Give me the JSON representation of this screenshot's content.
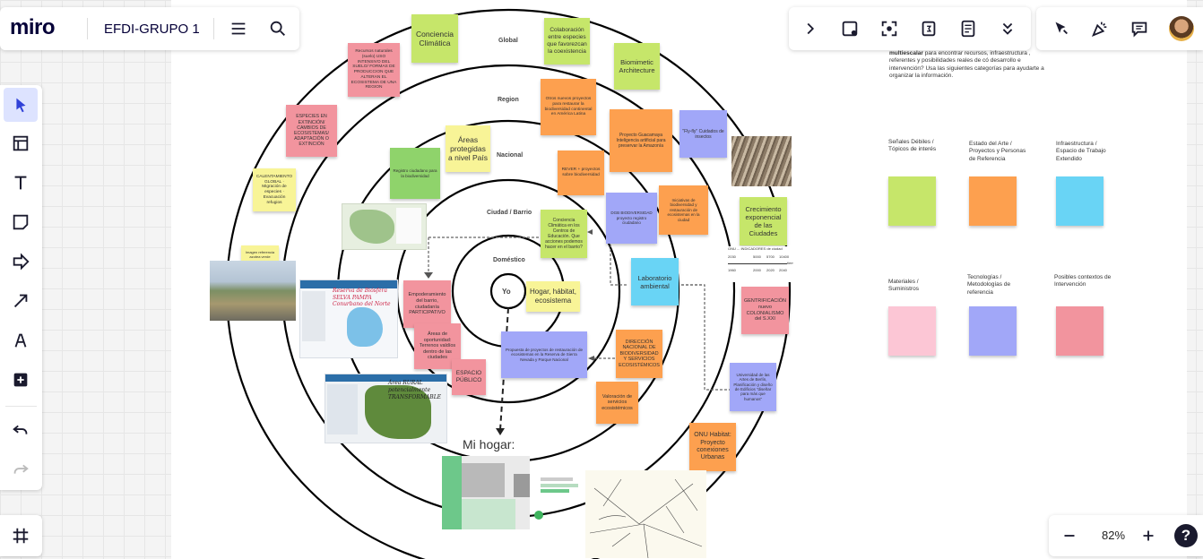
{
  "board": {
    "logo": "miro",
    "title": "EFDI-GRUPO 1",
    "zoom": "82%",
    "help": "?"
  },
  "colors": {
    "accent": "#4262ff",
    "yellow": "#f8f497",
    "green": "#c6e66a",
    "orange": "#fda04f",
    "blue": "#69d4f5",
    "violet": "#a1a7f8",
    "pink": "#f2949e"
  },
  "toolbar_icons": [
    "menu-icon",
    "search-icon",
    "chevron-right-icon",
    "frame-apps-icon",
    "focus-icon",
    "timer-icon",
    "notes-icon",
    "chevron-double-down-icon",
    "cursor-off-icon",
    "reaction-icon",
    "comments-icon",
    "avatar"
  ],
  "left_tools": [
    "select-icon",
    "frame-icon",
    "text-icon",
    "sticky-note-icon",
    "shape-icon",
    "connector-icon",
    "pen-icon",
    "add-icon",
    "undo-icon",
    "redo-icon"
  ],
  "rings": {
    "global": "Global",
    "region": "Region",
    "nacional": "Nacional",
    "ciudad": "Ciudad / Barrio",
    "domestico": "Doméstico",
    "center": "Yo"
  },
  "legend": {
    "intro_bold": "multiescalar",
    "intro_before": "para encontrar recursos, infraestructura ,",
    "intro_lines": [
      "referentes y posibilidades reales de có desarrollo e",
      "intervención? Usa las siguientes categorías para ayudarte a",
      "organizar la información."
    ],
    "cat1": "Señales Débiles / Tópicos de interés",
    "cat2": "Estado del Arte / Proyectos y Personas de Referencia",
    "cat3": "Infraestructura / Espacio de Trabajo Extendido",
    "cat4": "Materiales / Suministros",
    "cat5": "Tecnologías / Metodologías de referencia",
    "cat6": "Posibles contextos de Intervención"
  },
  "notes": {
    "conciencia_climatica": "Conciencia Climática",
    "colaboracion": "Colaboración entre especies que favorezcan la coexistencia",
    "biomimetic": "Biomimetic Architecture",
    "recursos_naturales": "Recursos naturales (suelo) USO INTENSIVO DEL SUELO/ FORMAS DE PRODUCCION QUE ALTERAN EL ECOSISTEMA DE UNA REGION",
    "especies_extincion": "ESPECIES EN EXTINCIÓN/ CAMBIOS DE ECOSISTEMAS/ ADAPTACIÓN O EXTINCIÓN",
    "calentamiento": "CALENTAMIENTO GLOBAL · Migración de especies · Evacuación refugios",
    "areas_protegidas": "Áreas protegidas a nivel País",
    "registro_biodiversidad": "Registro ciudadano para la biodiversidad",
    "proyectos_orange1": "Otros nuevos proyectos para restaurar la biodiversidad continental en América Latina",
    "proyecto_guacamaya": "Proyecto Guacamaya Inteligencia artificial para preservar la Amazonía",
    "fly_fly": "\"Fly-fly\" Cuidados de insectos",
    "orange_small": "REVER + proyectos sobre biodiversidad",
    "violet_note1": "DGB BIODIVERSIDAD proyecto registro ciudadano",
    "orange_note2": "Iniciativas de biodiversidad y restauración de ecosistemas en la ciudad",
    "crecimiento": "Crecimiento exponencial de las Ciudades",
    "conciencia_educacion": "Conciencia Climática en los Centros de Educación. Que acciones podemos hacer en el barrio?",
    "laboratorio": "Laboratorio ambiental",
    "gentrificacion": "GENTRIFICACIÓN nuevo COLONIALISMO del S.XXI",
    "hogar_habitat": "Hogar, hábitat, ecosistema",
    "empoderamiento": "Empoderamiento del barrio, ciudadanía PARTICIPATIVO",
    "areas_oportunidad": "Áreas de oportunidad: Terrenos valdíos dentro de las ciudades",
    "espacio_publico": "ESPACIO PÚBLICO",
    "propuesta": "Propuesta de proyectos de restauración de ecosistemas en la Reserva de Sierra Nevada y Parque Nacional",
    "direccion_nacional": "DIRECCIÓN NACIONAL DE BIODIVERSIDAD Y SERVICIOS ECOSISTÉMICOS",
    "valoracion": "Valoración de servicios ecosistémicos",
    "universidad": "Universidad de las Artes de Berlín, Planificación y diseño de Edificios \"diseñar para más que humanos\"",
    "onu_habitat": "ONU Habitat: Proyecto conexiones Urbanas",
    "yellow_small": "Imagen referencia azotea verde",
    "mi_hogar": "Mi hogar:"
  },
  "images": {
    "reserva": "Reserva de Biósfera SELVA PAMPA Conurbano del Norte",
    "area_rural": "Área RURAL potencialmente TRANSFORMABLE",
    "timeline_title": "ONU ... INDICADORES de ciudad",
    "timeline": [
      "2030",
      "5000",
      "5700",
      "10400",
      "1960",
      "2000",
      "2020",
      "2040"
    ],
    "timeline_axis": "tiempo"
  }
}
